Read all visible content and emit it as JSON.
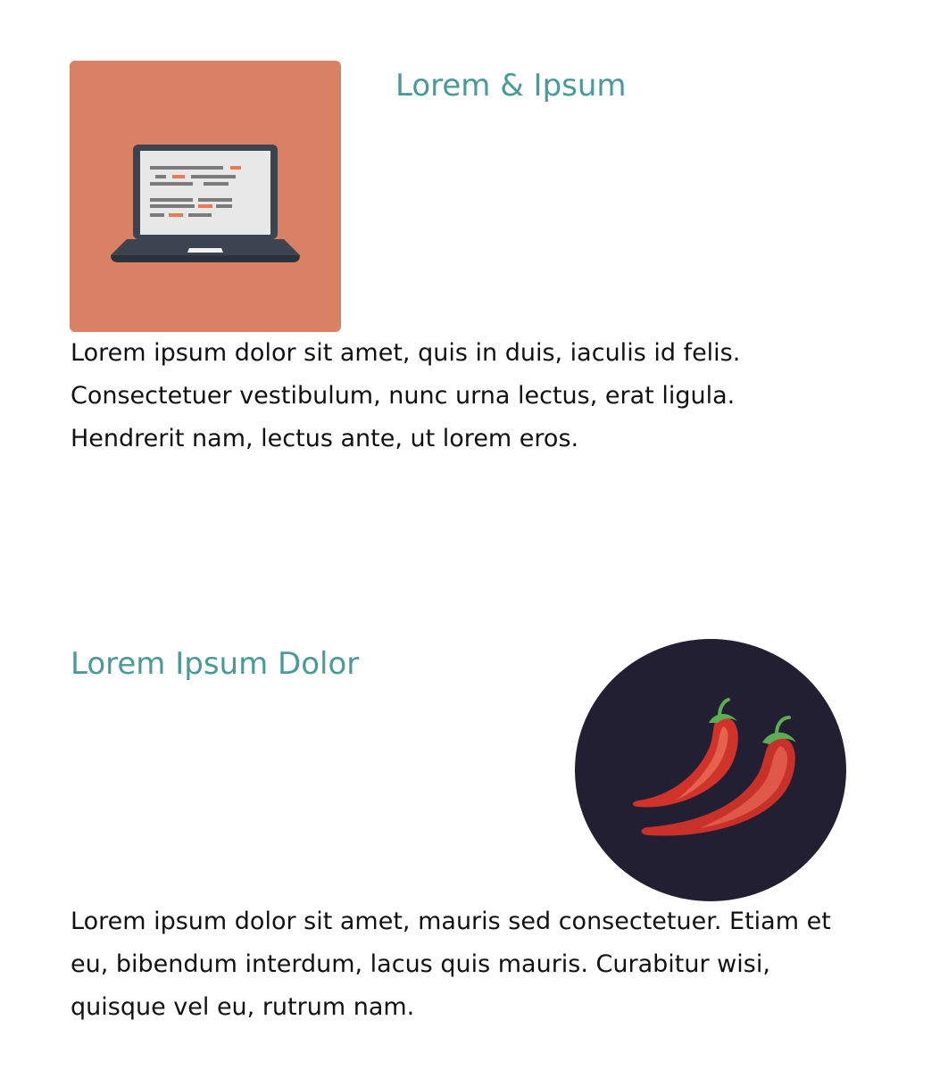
{
  "sections": [
    {
      "heading": "Lorem & Ipsum",
      "body": "Lorem ipsum dolor sit amet, quis in duis, iaculis id felis. Consectetuer vestibulum, nunc urna lectus, erat ligula. Hendrerit nam, lectus ante, ut lorem eros.",
      "image": {
        "icon": "laptop-icon",
        "background": "#d98065"
      }
    },
    {
      "heading": "Lorem Ipsum Dolor",
      "body": "Lorem ipsum dolor sit amet, mauris sed consectetuer. Etiam et eu, bibendum interdum, lacus quis mauris. Curabitur wisi, quisque vel eu, rutrum nam.",
      "image": {
        "icon": "chili-peppers-icon",
        "background": "#231f33"
      }
    }
  ],
  "colors": {
    "heading": "#4a9a9a",
    "text": "#111111",
    "pepper_red": "#d0332a",
    "stem_green": "#5cae55",
    "laptop_dark": "#3c4450",
    "screen": "#e8e8e8"
  }
}
